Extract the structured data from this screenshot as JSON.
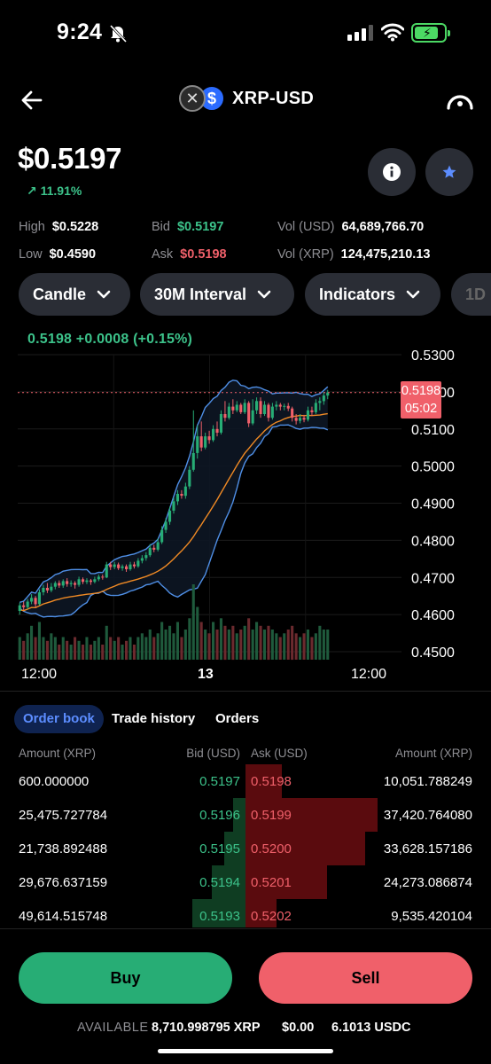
{
  "status_bar": {
    "time": "9:24"
  },
  "header": {
    "pair": "XRP-USD",
    "base_icon": "xrp-logo",
    "quote_icon": "usd-coin-logo"
  },
  "ticker": {
    "price": "$0.5197",
    "change": "↗ 11.91%",
    "high_label": "High",
    "high": "$0.5228",
    "low_label": "Low",
    "low": "$0.4590",
    "bid_label": "Bid",
    "bid": "$0.5197",
    "ask_label": "Ask",
    "ask": "$0.5198",
    "vol_usd_label": "Vol (USD)",
    "vol_usd": "64,689,766.70",
    "vol_xrp_label": "Vol (XRP)",
    "vol_xrp": "124,475,210.13"
  },
  "controls": {
    "chart_type": "Candle",
    "interval": "30M Interval",
    "indicators": "Indicators",
    "range_partial": "1D"
  },
  "chart_data": {
    "type": "candlestick",
    "header": "0.5198 +0.0008 (+0.15%)",
    "y_ticks": [
      "0.5300",
      "0.5200",
      "0.5100",
      "0.5000",
      "0.4900",
      "0.4800",
      "0.4700",
      "0.4600",
      "0.4500"
    ],
    "ylim": [
      0.45,
      0.53
    ],
    "x_ticks": [
      "12:00",
      "13",
      "12:00"
    ],
    "last_price_tag": "0.5198",
    "countdown": "05:02",
    "last_price": 0.5198,
    "candles": [
      [
        0.461,
        0.4625,
        0.46,
        0.4632
      ],
      [
        0.4625,
        0.462,
        0.4612,
        0.4635
      ],
      [
        0.462,
        0.4635,
        0.4615,
        0.4642
      ],
      [
        0.4635,
        0.4645,
        0.4628,
        0.4655
      ],
      [
        0.4645,
        0.4628,
        0.462,
        0.465
      ],
      [
        0.4628,
        0.466,
        0.4625,
        0.4668
      ],
      [
        0.466,
        0.4672,
        0.4652,
        0.468
      ],
      [
        0.4672,
        0.4665,
        0.4658,
        0.4685
      ],
      [
        0.4665,
        0.4675,
        0.466,
        0.4685
      ],
      [
        0.4675,
        0.4685,
        0.4668,
        0.469
      ],
      [
        0.4685,
        0.4678,
        0.4672,
        0.4692
      ],
      [
        0.4678,
        0.469,
        0.4672,
        0.4695
      ],
      [
        0.469,
        0.4682,
        0.4675,
        0.4698
      ],
      [
        0.4682,
        0.4685,
        0.4675,
        0.4692
      ],
      [
        0.4685,
        0.468,
        0.467,
        0.469
      ],
      [
        0.468,
        0.4695,
        0.4675,
        0.4702
      ],
      [
        0.4695,
        0.4688,
        0.4682,
        0.47
      ],
      [
        0.4688,
        0.4692,
        0.4682,
        0.4698
      ],
      [
        0.4692,
        0.4688,
        0.468,
        0.4696
      ],
      [
        0.4688,
        0.4695,
        0.4684,
        0.4702
      ],
      [
        0.4695,
        0.4702,
        0.469,
        0.4708
      ],
      [
        0.4702,
        0.47,
        0.4694,
        0.4708
      ],
      [
        0.47,
        0.4735,
        0.4698,
        0.4742
      ],
      [
        0.4735,
        0.4728,
        0.472,
        0.4742
      ],
      [
        0.4728,
        0.4735,
        0.4722,
        0.4742
      ],
      [
        0.4735,
        0.4725,
        0.472,
        0.474
      ],
      [
        0.4725,
        0.473,
        0.4718,
        0.4735
      ],
      [
        0.473,
        0.4722,
        0.4715,
        0.4735
      ],
      [
        0.4722,
        0.4735,
        0.4718,
        0.4742
      ],
      [
        0.4735,
        0.473,
        0.4724,
        0.4742
      ],
      [
        0.473,
        0.4745,
        0.4726,
        0.4752
      ],
      [
        0.4745,
        0.4752,
        0.4738,
        0.476
      ],
      [
        0.4752,
        0.476,
        0.4745,
        0.4768
      ],
      [
        0.476,
        0.478,
        0.4755,
        0.479
      ],
      [
        0.478,
        0.4775,
        0.4768,
        0.4788
      ],
      [
        0.4775,
        0.4795,
        0.477,
        0.4805
      ],
      [
        0.4795,
        0.4828,
        0.479,
        0.4838
      ],
      [
        0.4828,
        0.485,
        0.482,
        0.486
      ],
      [
        0.485,
        0.488,
        0.4842,
        0.489
      ],
      [
        0.488,
        0.4905,
        0.4872,
        0.4915
      ],
      [
        0.4905,
        0.4925,
        0.4895,
        0.4935
      ],
      [
        0.4925,
        0.492,
        0.4912,
        0.4935
      ],
      [
        0.492,
        0.4945,
        0.4912,
        0.4955
      ],
      [
        0.4945,
        0.499,
        0.4938,
        0.5
      ],
      [
        0.499,
        0.5035,
        0.4985,
        0.515
      ],
      [
        0.5035,
        0.508,
        0.502,
        0.511
      ],
      [
        0.508,
        0.505,
        0.504,
        0.512
      ],
      [
        0.505,
        0.508,
        0.5045,
        0.509
      ],
      [
        0.508,
        0.507,
        0.506,
        0.5095
      ],
      [
        0.507,
        0.51,
        0.5065,
        0.511
      ],
      [
        0.51,
        0.509,
        0.508,
        0.512
      ],
      [
        0.509,
        0.514,
        0.5085,
        0.515
      ],
      [
        0.514,
        0.513,
        0.512,
        0.5175
      ],
      [
        0.513,
        0.516,
        0.5125,
        0.517
      ],
      [
        0.516,
        0.515,
        0.514,
        0.518
      ],
      [
        0.515,
        0.5165,
        0.5145,
        0.5175
      ],
      [
        0.5165,
        0.5145,
        0.514,
        0.517
      ],
      [
        0.5145,
        0.517,
        0.514,
        0.518
      ],
      [
        0.517,
        0.5115,
        0.5105,
        0.5175
      ],
      [
        0.5115,
        0.515,
        0.511,
        0.518
      ],
      [
        0.515,
        0.5175,
        0.514,
        0.5185
      ],
      [
        0.5175,
        0.514,
        0.513,
        0.5185
      ],
      [
        0.514,
        0.5165,
        0.5135,
        0.5175
      ],
      [
        0.5165,
        0.513,
        0.512,
        0.517
      ],
      [
        0.513,
        0.516,
        0.5125,
        0.517
      ],
      [
        0.516,
        0.5165,
        0.515,
        0.5175
      ],
      [
        0.5165,
        0.516,
        0.515,
        0.517
      ],
      [
        0.516,
        0.5162,
        0.515,
        0.5168
      ],
      [
        0.5162,
        0.5155,
        0.5148,
        0.517
      ],
      [
        0.5155,
        0.513,
        0.512,
        0.516
      ],
      [
        0.513,
        0.5122,
        0.5112,
        0.514
      ],
      [
        0.5122,
        0.513,
        0.5115,
        0.514
      ],
      [
        0.513,
        0.5125,
        0.5118,
        0.5138
      ],
      [
        0.5125,
        0.515,
        0.512,
        0.516
      ],
      [
        0.515,
        0.5145,
        0.5135,
        0.516
      ],
      [
        0.5145,
        0.517,
        0.514,
        0.518
      ],
      [
        0.517,
        0.5175,
        0.515,
        0.5185
      ],
      [
        0.5175,
        0.519,
        0.5165,
        0.52
      ],
      [
        0.519,
        0.5198,
        0.518,
        0.5205
      ]
    ],
    "volume_rel": [
      0.3,
      0.25,
      0.35,
      0.45,
      0.3,
      0.5,
      0.3,
      0.25,
      0.35,
      0.3,
      0.2,
      0.3,
      0.25,
      0.2,
      0.3,
      0.25,
      0.2,
      0.3,
      0.2,
      0.25,
      0.3,
      0.2,
      0.45,
      0.3,
      0.25,
      0.3,
      0.2,
      0.25,
      0.3,
      0.2,
      0.3,
      0.35,
      0.3,
      0.4,
      0.3,
      0.35,
      0.5,
      0.4,
      0.45,
      0.35,
      0.5,
      0.3,
      0.4,
      0.55,
      1.0,
      0.7,
      0.5,
      0.4,
      0.35,
      0.5,
      0.4,
      0.55,
      0.45,
      0.4,
      0.45,
      0.35,
      0.4,
      0.45,
      0.55,
      0.4,
      0.5,
      0.45,
      0.4,
      0.45,
      0.4,
      0.35,
      0.3,
      0.35,
      0.4,
      0.45,
      0.35,
      0.3,
      0.35,
      0.4,
      0.3,
      0.35,
      0.45,
      0.4,
      0.4
    ]
  },
  "order_book": {
    "tabs": [
      "Order book",
      "Trade history",
      "Orders"
    ],
    "headers": {
      "amount": "Amount (XRP)",
      "bid": "Bid (USD)",
      "ask": "Ask (USD)",
      "ask_amount": "Amount (XRP)"
    },
    "rows": [
      {
        "bid_amount": "600.000000",
        "bid": "0.5197",
        "ask": "0.5198",
        "ask_amount": "10,051.788249",
        "bid_depth": 0.0,
        "ask_depth": 0.15
      },
      {
        "bid_amount": "25,475.727784",
        "bid": "0.5196",
        "ask": "0.5199",
        "ask_amount": "37,420.764080",
        "bid_depth": 0.17,
        "ask_depth": 0.55
      },
      {
        "bid_amount": "21,738.892488",
        "bid": "0.5195",
        "ask": "0.5200",
        "ask_amount": "33,628.157186",
        "bid_depth": 0.3,
        "ask_depth": 0.5
      },
      {
        "bid_amount": "29,676.637159",
        "bid": "0.5194",
        "ask": "0.5201",
        "ask_amount": "24,273.086874",
        "bid_depth": 0.47,
        "ask_depth": 0.34
      },
      {
        "bid_amount": "49,614.515748",
        "bid": "0.5193",
        "ask": "0.5202",
        "ask_amount": "9,535.420104",
        "bid_depth": 0.75,
        "ask_depth": 0.13
      }
    ]
  },
  "actions": {
    "buy": "Buy",
    "sell": "Sell"
  },
  "available": {
    "label": "AVAILABLE",
    "xrp": "8,710.998795 XRP",
    "usd": "$0.00",
    "usdc": "6.1013 USDC"
  },
  "colors": {
    "green": "#3cc28a",
    "red": "#f0606a",
    "accent": "#5c8dff",
    "button_bg": "#2a2d35"
  }
}
